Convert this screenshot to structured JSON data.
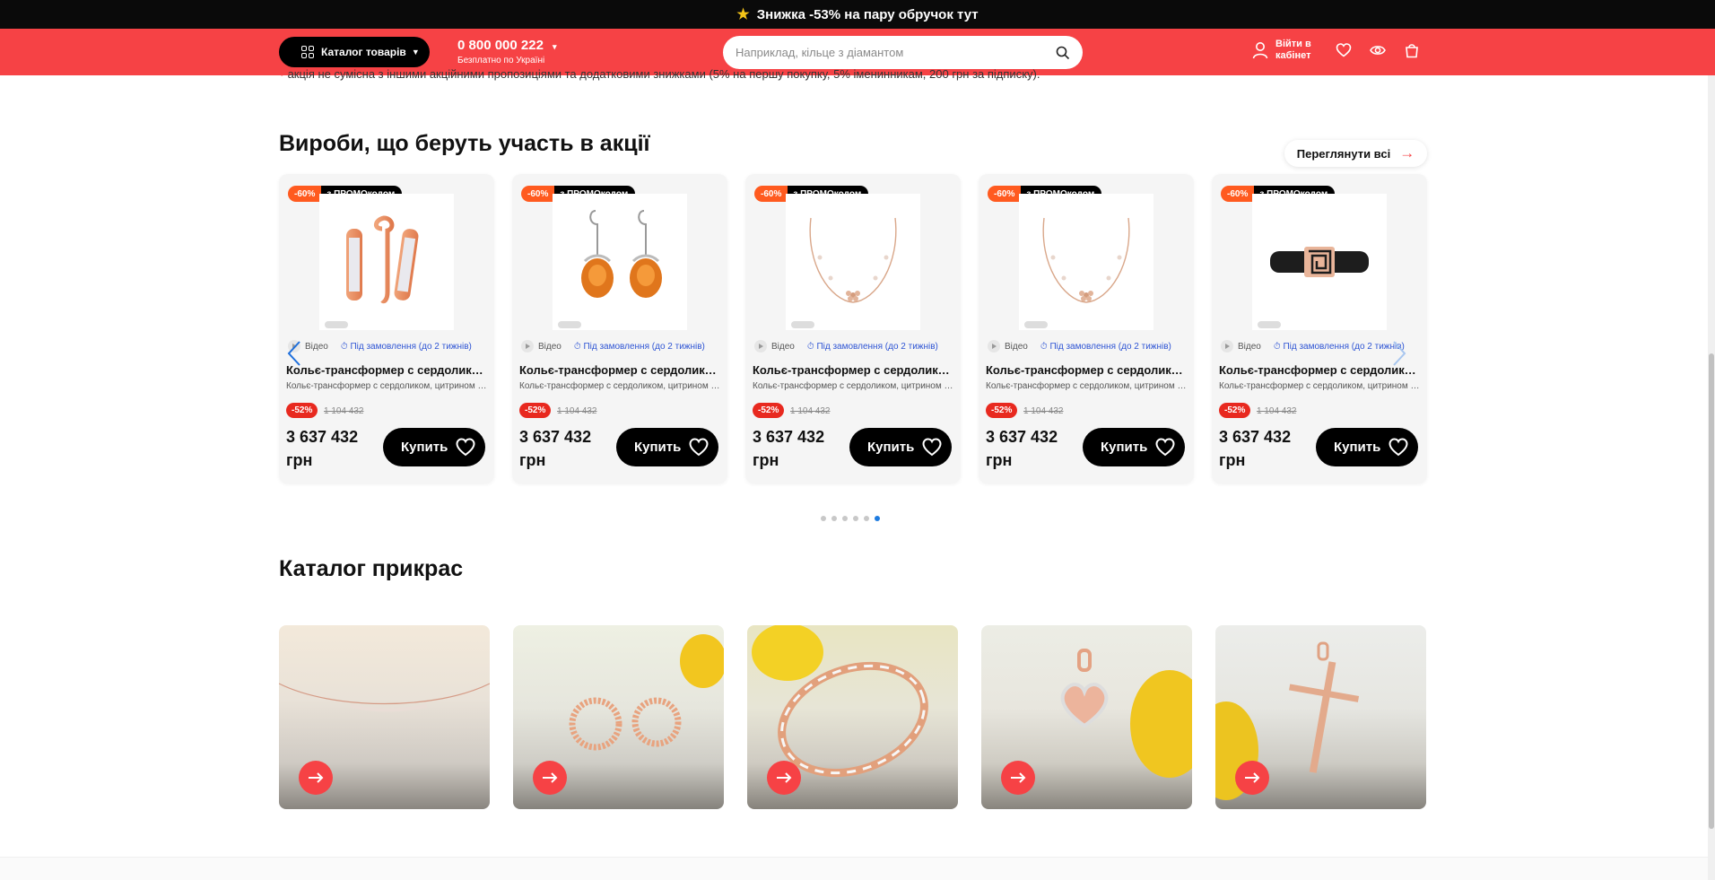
{
  "promo_bar": {
    "text": "Знижка -53% на пару обручок тут"
  },
  "header": {
    "catalog_label": "Каталог товарів",
    "phone": "0 800 000 222",
    "phone_sub": "Безплатно по Україні",
    "search_placeholder": "Наприклад, кільце з діамантом",
    "login_line1": "Війти в",
    "login_line2": "кабінет"
  },
  "notice": {
    "text": "акція не сумісна з іншими акційними пропозиціями та додатковими знижками (5% на першу покупку, 5% іменинникам, 200 грн за підписку)."
  },
  "promo_section": {
    "title": "Вироби, що беруть участь в акції",
    "view_all": "Переглянути всі",
    "products": [
      {
        "discount_tag": "-60%",
        "promo_tag": "з ПРОМОкодом",
        "video": "Відео",
        "availability": "Під замовлення (до 2 тижнів)",
        "name": "Кольє-трансформер с сердоликом, цитрином и …",
        "description": "Кольє-трансформер с сердоликом, цитрином и …",
        "badge": "-52%",
        "old_price": "1 104 432",
        "price": "3 637 432 грн",
        "buy": "Купить",
        "image": "earrings-stones-icon"
      },
      {
        "discount_tag": "-60%",
        "promo_tag": "з ПРОМОкодом",
        "video": "Відео",
        "availability": "Під замовлення (до 2 тижнів)",
        "name": "Кольє-трансформер с сердоликом, цитрином и …",
        "description": "Кольє-трансформер с сердоликом, цитрином и …",
        "badge": "-52%",
        "old_price": "1 104 432",
        "price": "3 637 432 грн",
        "buy": "Купить",
        "image": "amber-earrings-icon"
      },
      {
        "discount_tag": "-60%",
        "promo_tag": "з ПРОМОкодом",
        "video": "Відео",
        "availability": "Під замовлення (до 2 тижнів)",
        "name": "Кольє-трансформер с сердоликом, цитрином и …",
        "description": "Кольє-трансформер с сердоликом, цитрином и …",
        "badge": "-52%",
        "old_price": "1 104 432",
        "price": "3 637 432 грн",
        "buy": "Купить",
        "image": "bracelet-chain-icon"
      },
      {
        "discount_tag": "-60%",
        "promo_tag": "з ПРОМОкодом",
        "video": "Відео",
        "availability": "Під замовлення (до 2 тижнів)",
        "name": "Кольє-трансформер с сердоликом, цитрином и …",
        "description": "Кольє-трансформер с сердоликом, цитрином и …",
        "badge": "-52%",
        "old_price": "1 104 432",
        "price": "3 637 432 грн",
        "buy": "Купить",
        "image": "bracelet-chain-icon"
      },
      {
        "discount_tag": "-60%",
        "promo_tag": "з ПРОМОкодом",
        "video": "Відео",
        "availability": "Під замовлення (до 2 тижнів)",
        "name": "Кольє-трансформер с сердоликом, цитрином и …",
        "description": "Кольє-трансформер с сердоликом, цитрином и …",
        "badge": "-52%",
        "old_price": "1 104 432",
        "price": "3 637 432 грн",
        "buy": "Купить",
        "image": "leather-bracelet-icon"
      }
    ],
    "pagination": {
      "total": 6,
      "active": 6
    }
  },
  "catalog_section": {
    "title": "Каталог прикрас",
    "tiles": [
      {
        "image": "necklace-icon"
      },
      {
        "image": "earrings-icon"
      },
      {
        "image": "bracelet-icon"
      },
      {
        "image": "heart-pendant-icon"
      },
      {
        "image": "cross-pendant-icon"
      }
    ]
  },
  "colors": {
    "accent": "#f64245",
    "dark": "#000000",
    "link": "#2f55d4",
    "badge": "#e8291f",
    "dot_active": "#1e7be0"
  }
}
